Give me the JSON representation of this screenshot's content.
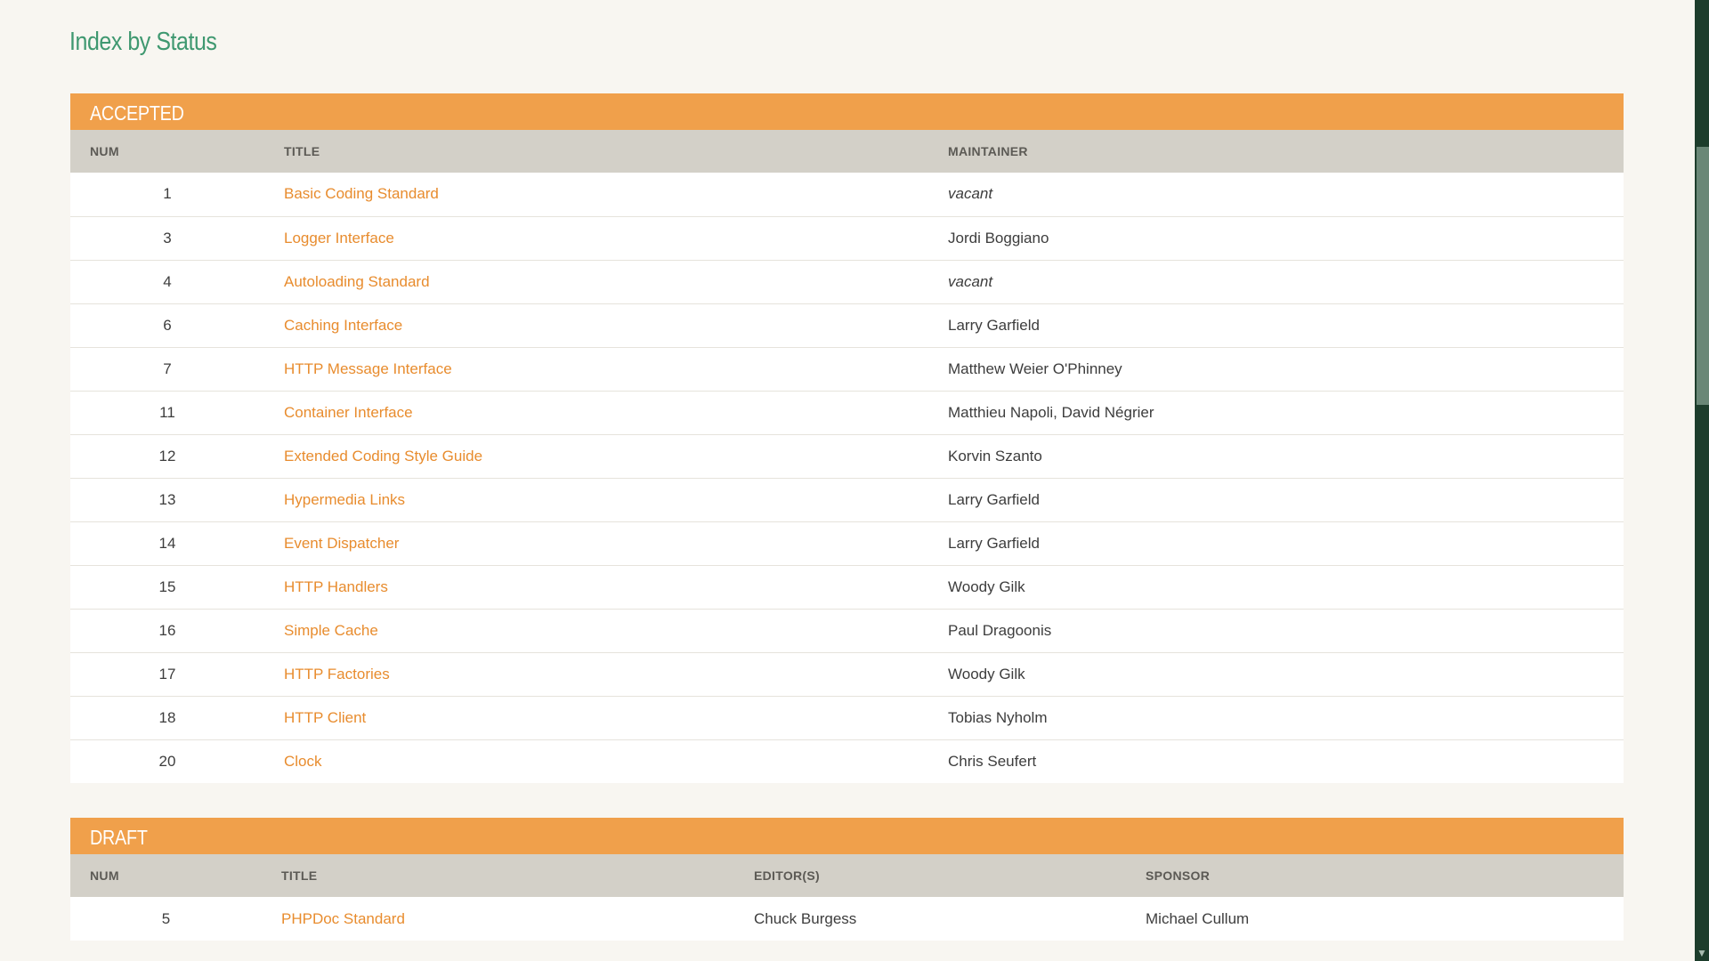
{
  "page": {
    "title": "Index by Status"
  },
  "accepted": {
    "heading": "ACCEPTED",
    "columns": {
      "num": "NUM",
      "title": "TITLE",
      "maintainer": "MAINTAINER"
    },
    "rows": [
      {
        "num": "1",
        "title": "Basic Coding Standard",
        "maintainer": "vacant"
      },
      {
        "num": "3",
        "title": "Logger Interface",
        "maintainer": "Jordi Boggiano"
      },
      {
        "num": "4",
        "title": "Autoloading Standard",
        "maintainer": "vacant"
      },
      {
        "num": "6",
        "title": "Caching Interface",
        "maintainer": "Larry Garfield"
      },
      {
        "num": "7",
        "title": "HTTP Message Interface",
        "maintainer": "Matthew Weier O'Phinney"
      },
      {
        "num": "11",
        "title": "Container Interface",
        "maintainer": "Matthieu Napoli, David Négrier"
      },
      {
        "num": "12",
        "title": "Extended Coding Style Guide",
        "maintainer": "Korvin Szanto"
      },
      {
        "num": "13",
        "title": "Hypermedia Links",
        "maintainer": "Larry Garfield"
      },
      {
        "num": "14",
        "title": "Event Dispatcher",
        "maintainer": "Larry Garfield"
      },
      {
        "num": "15",
        "title": "HTTP Handlers",
        "maintainer": "Woody Gilk"
      },
      {
        "num": "16",
        "title": "Simple Cache",
        "maintainer": "Paul Dragoonis"
      },
      {
        "num": "17",
        "title": "HTTP Factories",
        "maintainer": "Woody Gilk"
      },
      {
        "num": "18",
        "title": "HTTP Client",
        "maintainer": "Tobias Nyholm"
      },
      {
        "num": "20",
        "title": "Clock",
        "maintainer": "Chris Seufert"
      }
    ]
  },
  "draft": {
    "heading": "DRAFT",
    "columns": {
      "num": "NUM",
      "title": "TITLE",
      "editors": "EDITOR(S)",
      "sponsor": "SPONSOR"
    },
    "rows": [
      {
        "num": "5",
        "title": "PHPDoc Standard",
        "editors": "Chuck Burgess",
        "sponsor": "Michael Cullum"
      }
    ]
  },
  "colors": {
    "accent": "#f0a04b",
    "link": "#e88c2e",
    "title": "#3f9870",
    "header_row": "#d3d0c8",
    "scrollbar": "#1d3d2c"
  }
}
